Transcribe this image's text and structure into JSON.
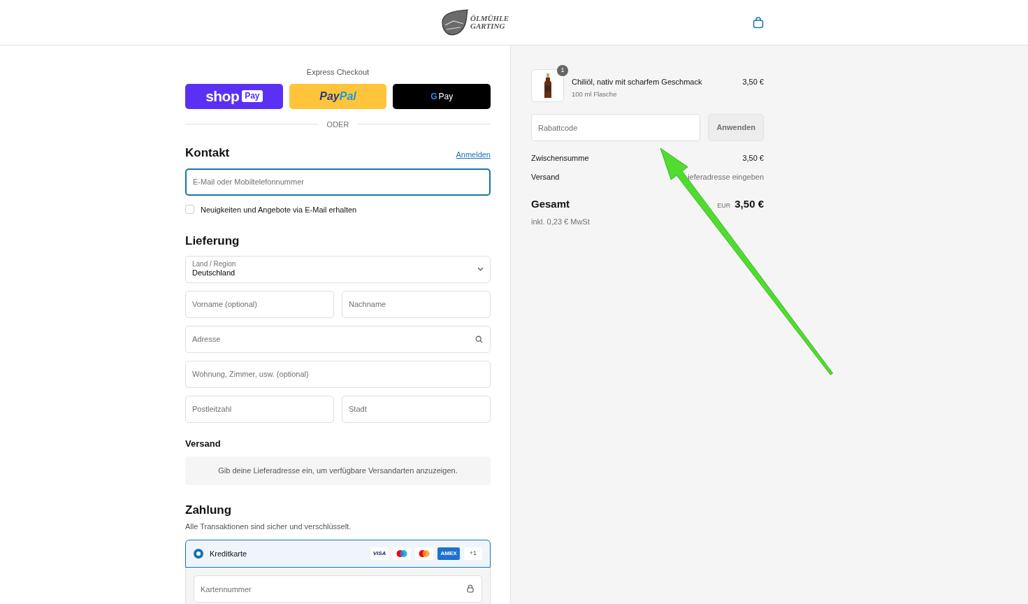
{
  "header": {
    "logo_lines": [
      "ÖLMÜHLE",
      "GARTING"
    ]
  },
  "express": {
    "title": "Express Checkout",
    "buttons": [
      {
        "kind": "shoppay",
        "text": "shop",
        "badge": "Pay"
      },
      {
        "kind": "paypal",
        "text": "Pay",
        "text2": "Pal"
      },
      {
        "kind": "gpay",
        "text": "G",
        "text2": "Pay"
      }
    ],
    "divider": "ODER"
  },
  "contact": {
    "title": "Kontakt",
    "link": "Anmelden",
    "email": {
      "placeholder": "E-Mail oder Mobiltelefonnummer",
      "focused": true
    },
    "newsletter": {
      "label": "Neuigkeiten und Angebote via E-Mail erhalten",
      "checked": false
    }
  },
  "delivery": {
    "title": "Lieferung",
    "rows": [
      [
        {
          "kind": "select",
          "label": "Land / Region",
          "value": "Deutschland"
        }
      ],
      [
        {
          "kind": "text",
          "placeholder": "Vorname (optional)"
        },
        {
          "kind": "text",
          "placeholder": "Nachname"
        }
      ],
      [
        {
          "kind": "search",
          "placeholder": "Adresse"
        }
      ],
      [
        {
          "kind": "text",
          "placeholder": "Wohnung, Zimmer, usw. (optional)"
        }
      ],
      [
        {
          "kind": "text",
          "placeholder": "Postleitzahl"
        },
        {
          "kind": "text",
          "placeholder": "Stadt"
        }
      ]
    ]
  },
  "shipping": {
    "title": "Versand",
    "notice": "Gib deine Lieferadresse ein, um verfügbare Versandarten anzuzeigen."
  },
  "payment": {
    "title": "Zahlung",
    "subtitle": "Alle Transaktionen sind sicher und verschlüsselt.",
    "methods": [
      {
        "label": "Kreditkarte",
        "selected": true,
        "cards": [
          {
            "kind": "visa",
            "text": "VISA"
          },
          {
            "kind": "maestro"
          },
          {
            "kind": "mastercard"
          },
          {
            "kind": "amex",
            "text": "AMEX"
          },
          {
            "kind": "more",
            "text": "+1"
          }
        ]
      }
    ],
    "card_fields": [
      {
        "kind": "secure",
        "placeholder": "Kartennummer"
      }
    ]
  },
  "summary": {
    "items": [
      {
        "name": "Chiliöl, nativ mit scharfem Geschmack",
        "variant": "100 ml Flasche",
        "price": "3,50 €",
        "quantity": "1"
      }
    ],
    "discount": {
      "placeholder": "Rabattcode",
      "button": "Anwenden"
    },
    "lines": [
      {
        "label": "Zwischensumme",
        "value": "3,50 €",
        "muted": false
      },
      {
        "label": "Versand",
        "value": "ieferadresse eingeben",
        "muted": true
      }
    ],
    "total": {
      "label": "Gesamt",
      "currency": "EUR",
      "value": "3,50 €",
      "tax": "inkl. 0,23 € MwSt"
    }
  }
}
